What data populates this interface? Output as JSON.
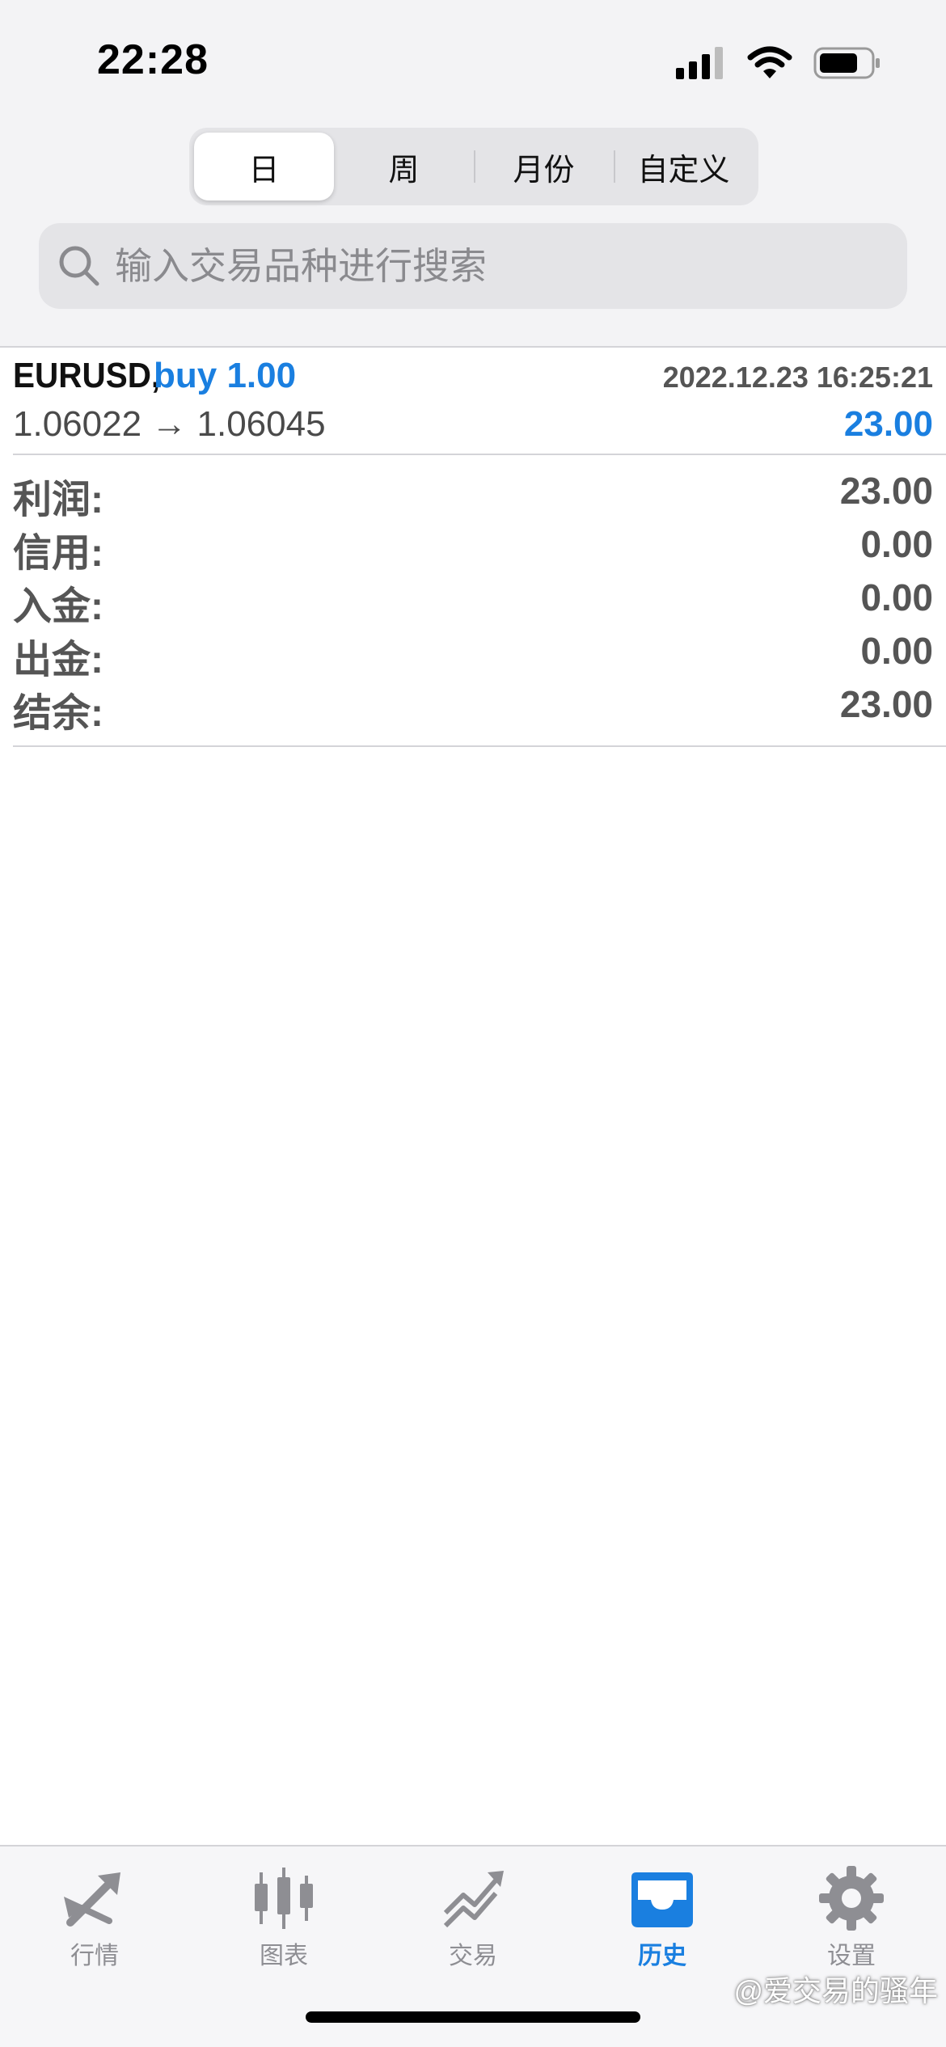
{
  "status_bar": {
    "time": "22:28"
  },
  "segment": {
    "tabs": [
      "日",
      "周",
      "月份",
      "自定义"
    ],
    "active_index": 0
  },
  "search": {
    "placeholder": "输入交易品种进行搜索"
  },
  "trade": {
    "symbol": "EURUSD,",
    "side": "buy 1.00",
    "time": "2022.12.23 16:25:21",
    "price_range": "1.06022 → 1.06045",
    "profit": "23.00"
  },
  "summary": {
    "rows": [
      {
        "label": "利润:",
        "value": "23.00"
      },
      {
        "label": "信用:",
        "value": "0.00"
      },
      {
        "label": "入金:",
        "value": "0.00"
      },
      {
        "label": "出金:",
        "value": "0.00"
      },
      {
        "label": "结余:",
        "value": "23.00"
      }
    ]
  },
  "tab_bar": {
    "items": [
      {
        "label": "行情",
        "icon": "quotes-arrows-icon"
      },
      {
        "label": "图表",
        "icon": "candlestick-chart-icon"
      },
      {
        "label": "交易",
        "icon": "trade-trend-icon"
      },
      {
        "label": "历史",
        "icon": "history-inbox-icon"
      },
      {
        "label": "设置",
        "icon": "gear-icon"
      }
    ],
    "active_index": 3
  },
  "colors": {
    "accent": "#1a7fe0",
    "inactive": "#8e8e93"
  },
  "watermark": "@爱交易的骚年"
}
